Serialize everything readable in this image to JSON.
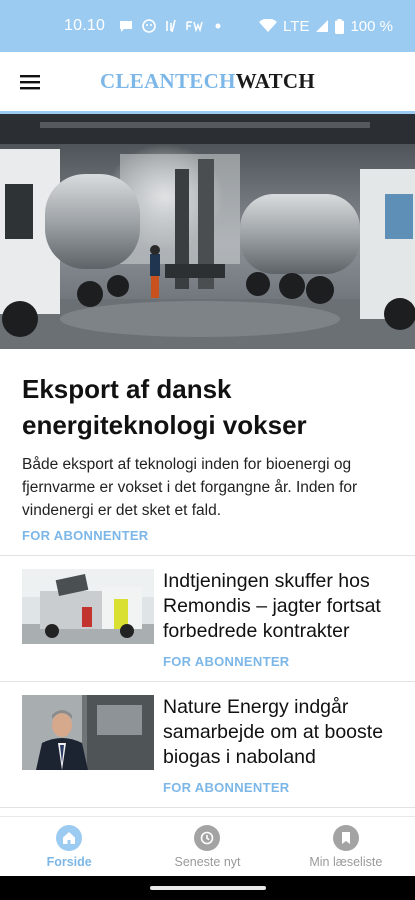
{
  "status_bar": {
    "time": "10.10",
    "notification_icons": [
      "chat-bubble-icon",
      "face-icon",
      "symbol-icon",
      "fw-icon",
      "dot-icon"
    ],
    "network": "LTE",
    "battery": "100 %"
  },
  "header": {
    "logo_part1": "CLEANTECH",
    "logo_part2": "WATCH"
  },
  "lead_article": {
    "title": "Eksport af dansk energiteknologi vokser",
    "summary": "Både eksport af teknologi inden for bioenergi og fjernvarme er vokset i det forgangne år. Inden for vindenergi er det sket et fald.",
    "tag": "FOR ABONNENTER"
  },
  "articles": [
    {
      "title": "Indtjeningen skuffer hos Remondis – jagter fortsat forbedrede kontrakter",
      "tag": "FOR ABONNENTER"
    },
    {
      "title": "Nature Energy indgår samarbejde om at booste biogas i naboland",
      "tag": "FOR ABONNENTER"
    }
  ],
  "bottom_nav": {
    "items": [
      {
        "label": "Forside",
        "icon": "home-icon",
        "active": true
      },
      {
        "label": "Seneste nyt",
        "icon": "clock-icon",
        "active": false
      },
      {
        "label": "Min læseliste",
        "icon": "bookmark-icon",
        "active": false
      }
    ]
  },
  "colors": {
    "accent": "#7cb7e8",
    "status_bar": "#9ccbf2"
  }
}
